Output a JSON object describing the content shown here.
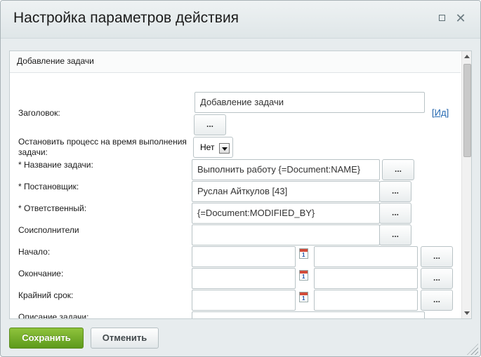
{
  "window": {
    "title": "Настройка параметров действия"
  },
  "section": {
    "title": "Добавление задачи"
  },
  "fields": {
    "title_label": "Заголовок:",
    "title_value": "Добавление задачи",
    "title_link": "Ид",
    "title_link_left": "[",
    "title_link_right": "]",
    "dots": "...",
    "stop_label": "Остановить процесс на время выполнения задачи:",
    "stop_value": "Нет",
    "task_name_label": "* Название задачи:",
    "task_name_value": "Выполнить работу {=Document:NAME}",
    "creator_label": "* Постановщик:",
    "creator_value": "Руслан Айткулов [43]",
    "responsible_label": "* Ответственный:",
    "responsible_value": "{=Document:MODIFIED_BY}",
    "accomplices_label": "Соисполнители",
    "accomplices_value": "",
    "start_label": "Начало:",
    "end_label": "Окончание:",
    "deadline_label": "Крайний срок:",
    "description_label": "Описание задачи:",
    "calendar_day": "1"
  },
  "buttons": {
    "save": "Сохранить",
    "cancel": "Отменить"
  },
  "colors": {
    "save_button": "#6aa626",
    "link": "#1e5fa8",
    "calendar_header": "#d24b3a"
  }
}
